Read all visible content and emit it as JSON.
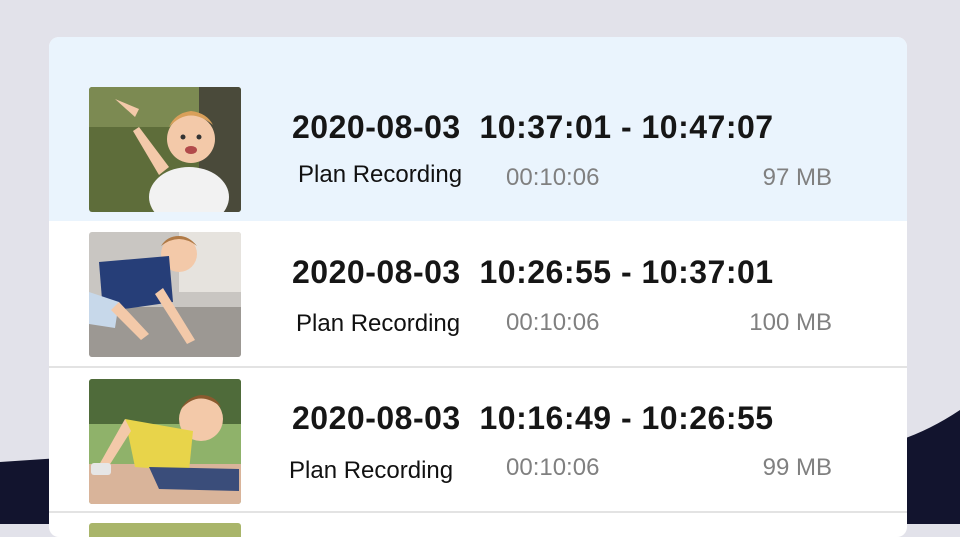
{
  "recordings": [
    {
      "date": "2020-08-03",
      "start": "10:37:01",
      "end": "10:47:07",
      "type": "Plan Recording",
      "duration": "00:10:06",
      "size": "97 MB",
      "thumbnail_icon": "child-pointing-thumbnail"
    },
    {
      "date": "2020-08-03",
      "start": "10:26:55",
      "end": "10:37:01",
      "type": "Plan Recording",
      "duration": "00:10:06",
      "size": "100 MB",
      "thumbnail_icon": "child-crawling-thumbnail"
    },
    {
      "date": "2020-08-03",
      "start": "10:16:49",
      "end": "10:26:55",
      "type": "Plan Recording",
      "duration": "00:10:06",
      "size": "99 MB",
      "thumbnail_icon": "child-playing-thumbnail"
    }
  ],
  "colors": {
    "highlight": "#eaf4fd",
    "page_bg": "#e2e2ea",
    "dark_wave": "#12142e"
  }
}
